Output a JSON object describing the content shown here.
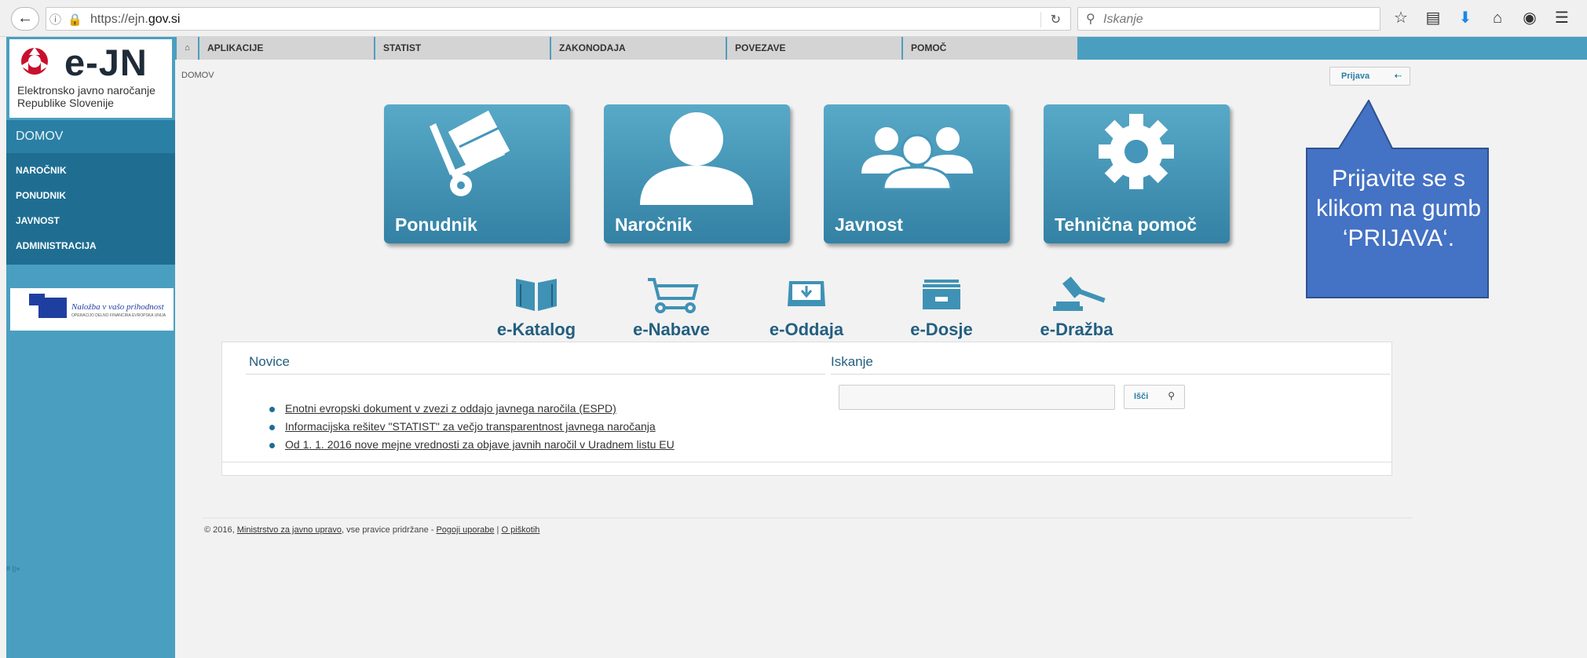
{
  "browser": {
    "url_prefix": "https://ejn.",
    "url_domain": "gov.si",
    "search_placeholder": "Iskanje"
  },
  "logo": {
    "name": "e-JN",
    "subtitle_line1": "Elektronsko javno naročanje",
    "subtitle_line2": "Republike Slovenije"
  },
  "sidebar": {
    "domov": "DOMOV",
    "items": [
      {
        "label": "NAROČNIK"
      },
      {
        "label": "PONUDNIK"
      },
      {
        "label": "JAVNOST"
      },
      {
        "label": "ADMINISTRACIJA"
      }
    ],
    "eu_banner": "Naložba v vašo prihodnost",
    "eu_small": "OPERACIJO DELNO FINANCIRA EVROPSKA UNIJA",
    "tiny_mark": "#  ||»"
  },
  "topnav": {
    "tabs": [
      {
        "label": "APLIKACIJE"
      },
      {
        "label": "STATIST"
      },
      {
        "label": "ZAKONODAJA"
      },
      {
        "label": "POVEZAVE"
      },
      {
        "label": "POMOČ"
      }
    ]
  },
  "breadcrumb": "DOMOV",
  "login_button": "Prijava",
  "tiles": [
    {
      "label": "Ponudnik",
      "icon": "hand-truck-icon"
    },
    {
      "label": "Naročnik",
      "icon": "person-icon"
    },
    {
      "label": "Javnost",
      "icon": "group-icon"
    },
    {
      "label": "Tehnična pomoč",
      "icon": "gear-icon"
    }
  ],
  "services": [
    {
      "label": "e-Katalog",
      "icon": "book-icon"
    },
    {
      "label": "e-Nabave",
      "icon": "cart-icon"
    },
    {
      "label": "e-Oddaja",
      "icon": "inbox-icon"
    },
    {
      "label": "e-Dosje",
      "icon": "archive-icon"
    },
    {
      "label": "e-Dražba",
      "icon": "gavel-icon"
    }
  ],
  "news": {
    "title": "Novice",
    "items": [
      {
        "text": "Enotni evropski dokument v zvezi z oddajo javnega naročila (ESPD)"
      },
      {
        "text": " Informacijska rešitev \"STATIST\" za večjo transparentnost javnega naročanja"
      },
      {
        "text": "Od 1. 1. 2016 nove mejne vrednosti za objave javnih naročil v Uradnem listu EU"
      }
    ]
  },
  "search": {
    "title": "Iskanje",
    "button": "Išči"
  },
  "footer": {
    "prefix": "© 2016, ",
    "ministry": "Ministrstvo za javno upravo",
    "rights": ", vse pravice pridržane  -  ",
    "terms": "Pogoji uporabe",
    "sep": "  |  ",
    "cookies": "O piškotih"
  },
  "callout": {
    "text": "Prijavite se s klikom na gumb ‘PRIJAVA‘."
  },
  "colors": {
    "sidebar": "#4a9fc1",
    "tile": "#3f92b5",
    "callout": "#4472c4"
  }
}
